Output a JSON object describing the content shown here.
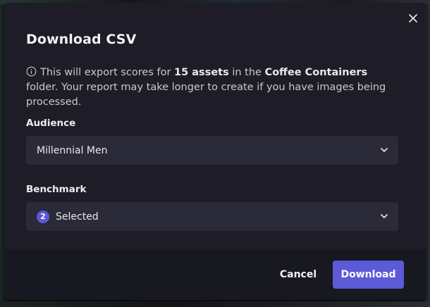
{
  "modal": {
    "title": "Download CSV",
    "info": {
      "prefix": "This will export scores for ",
      "asset_count": "15 assets",
      "middle": " in the ",
      "folder": "Coffee Containers",
      "suffix": " folder. Your report may take longer to create if you have images being processed."
    },
    "audience": {
      "label": "Audience",
      "value": "Millennial Men"
    },
    "benchmark": {
      "label": "Benchmark",
      "count": "2",
      "value": "Selected"
    },
    "footer": {
      "cancel_label": "Cancel",
      "download_label": "Download"
    }
  },
  "icons": [
    "close-icon",
    "info-icon",
    "chevron-down-icon"
  ],
  "colors": {
    "modal_bg": "#1d1c27",
    "footer_bg": "#181820",
    "select_bg": "#2b2a38",
    "accent": "#5b5ad7"
  }
}
